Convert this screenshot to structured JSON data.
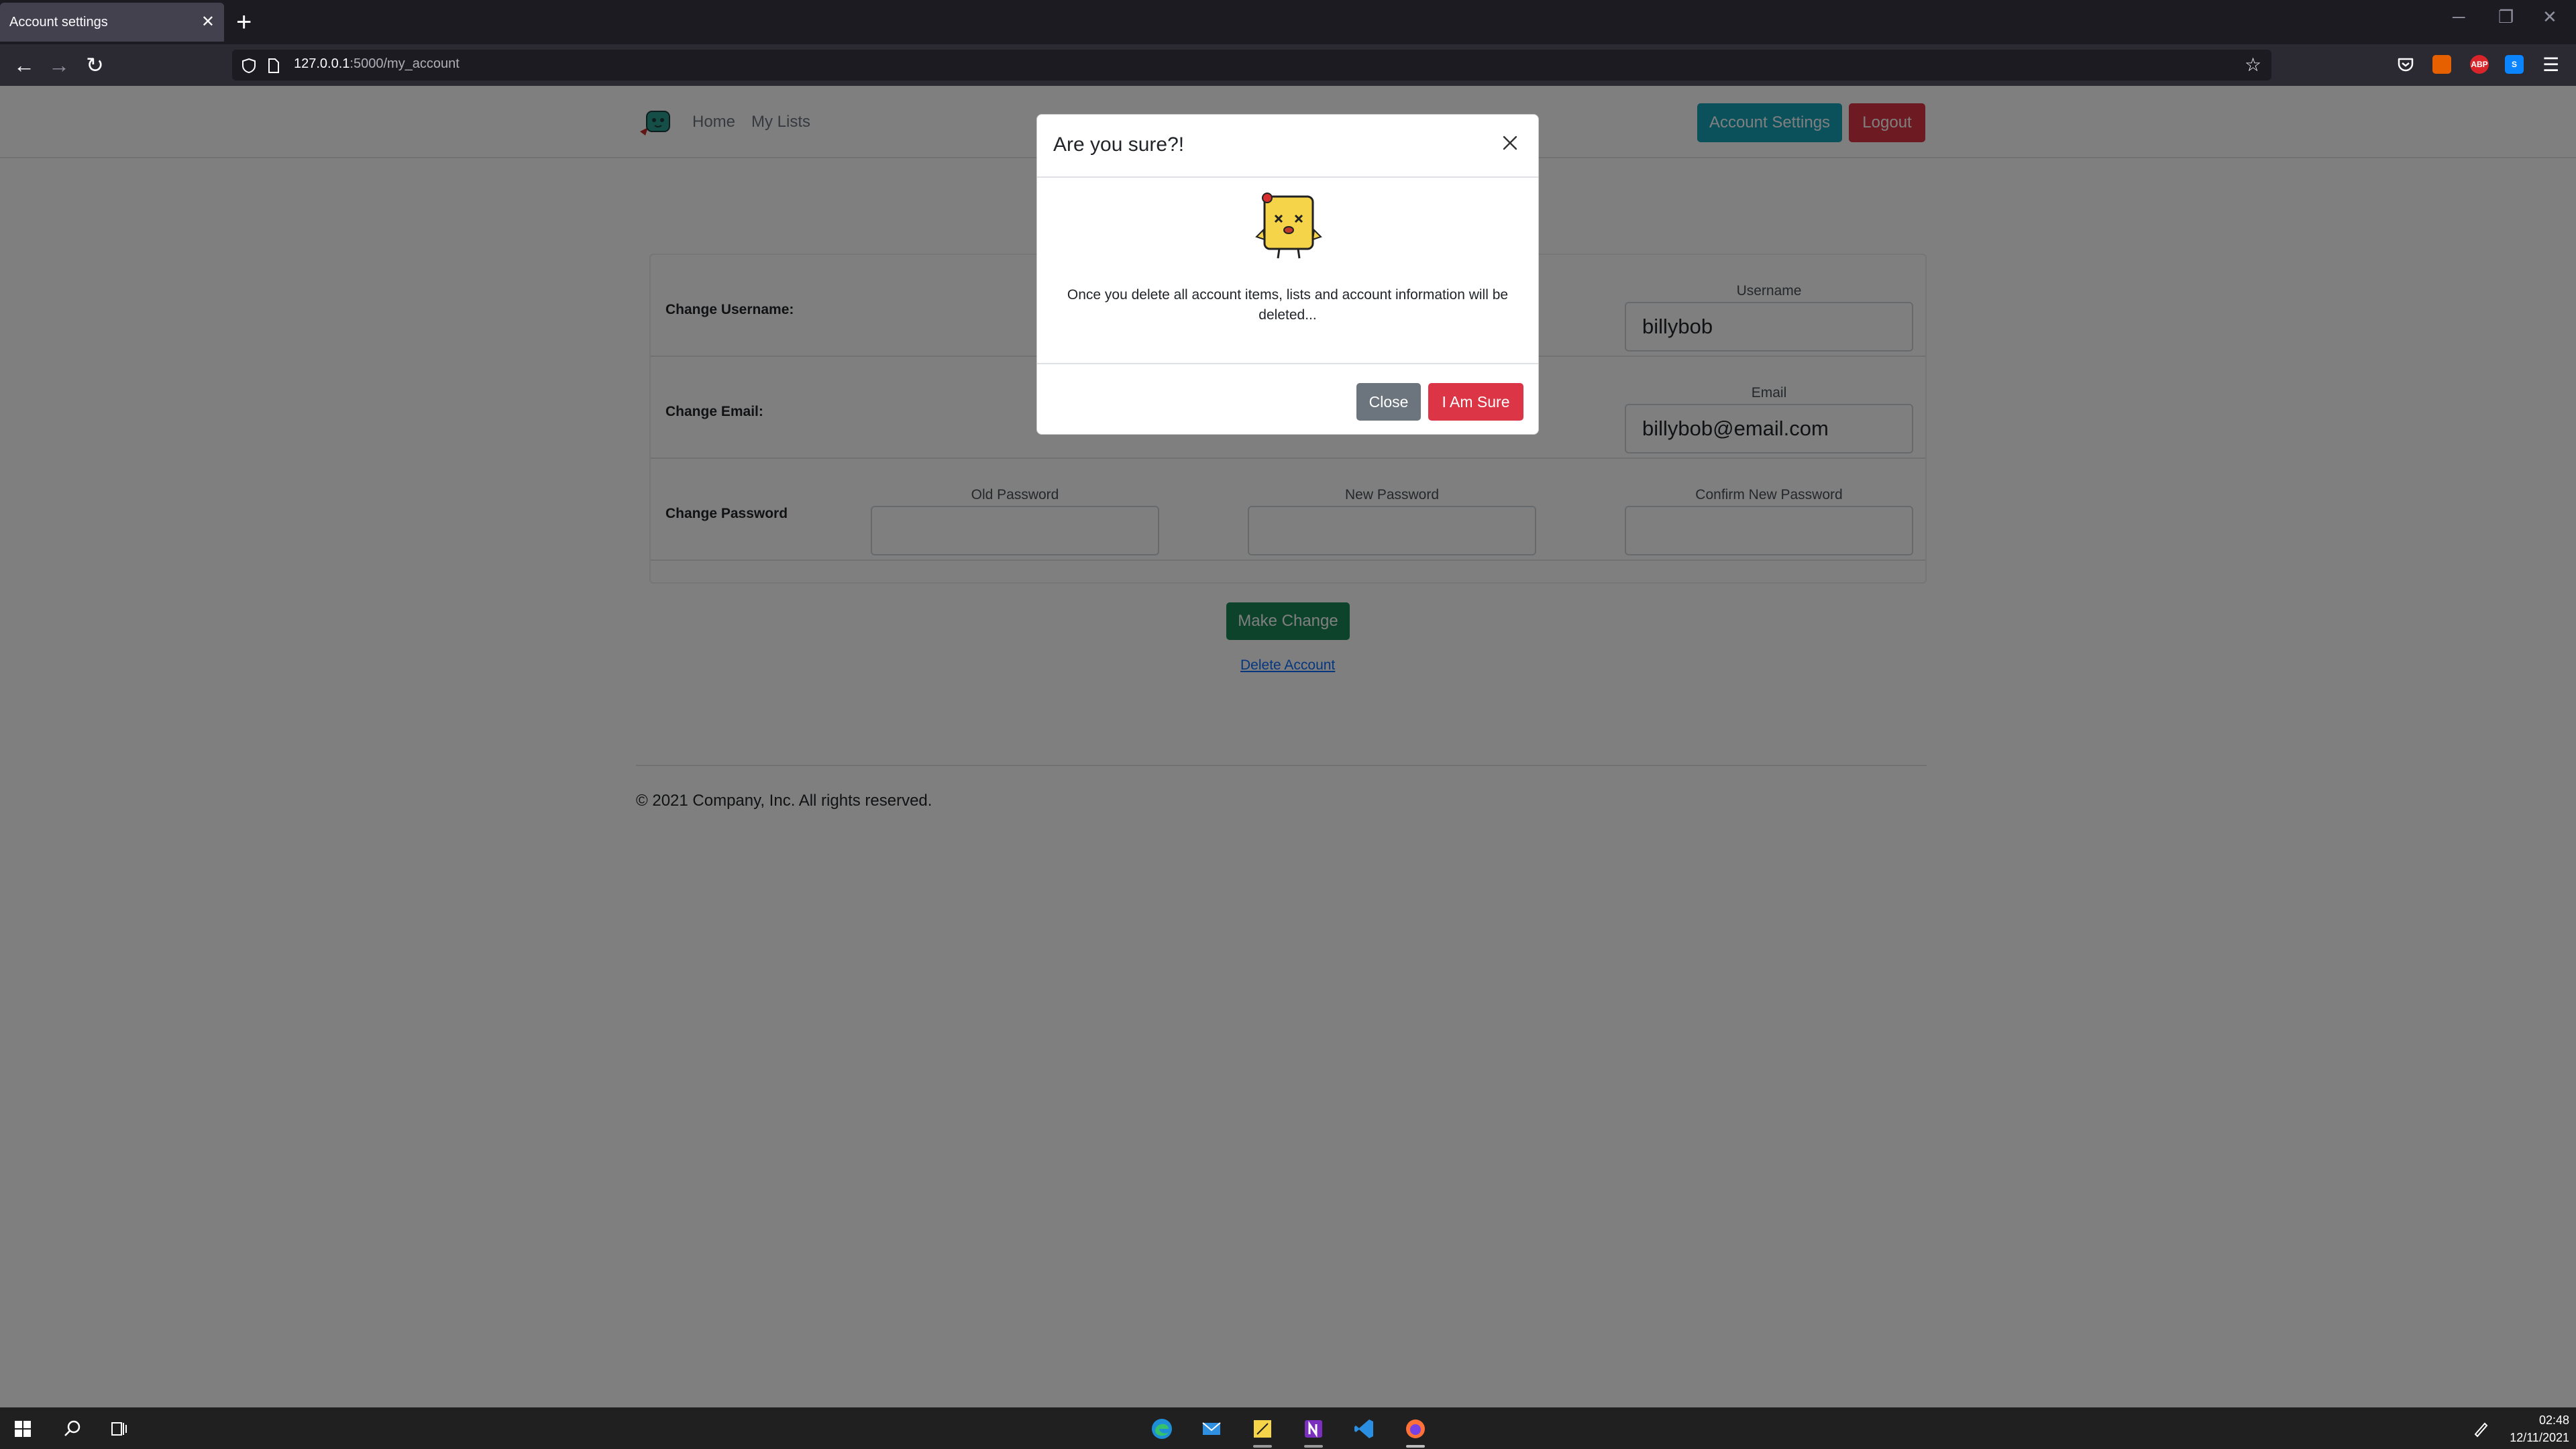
{
  "browser": {
    "tab_title": "Account settings",
    "tab_close": "✕",
    "new_tab": "+",
    "url_host": "127.0.0.1",
    "url_path": ":5000/my_account",
    "back": "←",
    "forward": "→",
    "reload": "↻",
    "bookmark": "☆",
    "menu": "☰",
    "minimize": "─",
    "restore": "❐",
    "close": "✕",
    "ext_abp": "ABP",
    "ext_s": "S"
  },
  "site": {
    "nav": {
      "home": "Home",
      "my_lists": "My Lists"
    },
    "account_settings_button": "Account Settings",
    "logout_button": "Logout",
    "rows": {
      "username": {
        "label": "Change Username:",
        "field_label": "Username",
        "value": "billybob"
      },
      "email": {
        "label": "Change Email:",
        "field_label": "Email",
        "value": "billybob@email.com"
      },
      "password": {
        "label": "Change Password",
        "old": "Old Password",
        "new": "New Password",
        "confirm": "Confirm New Password"
      }
    },
    "make_change_button": "Make Change",
    "delete_account_link": "Delete Account",
    "footer": "© 2021 Company, Inc. All rights reserved."
  },
  "modal": {
    "title": "Are you sure?!",
    "body": "Once you delete all account items, lists and account information will be deleted...",
    "close_button": "Close",
    "confirm_button": "I Am Sure"
  },
  "taskbar": {
    "time": "02:48",
    "date": "12/11/2021"
  },
  "colors": {
    "info": "#17a2b8",
    "danger": "#dc3545",
    "success": "#198754",
    "secondary": "#6c757d"
  }
}
